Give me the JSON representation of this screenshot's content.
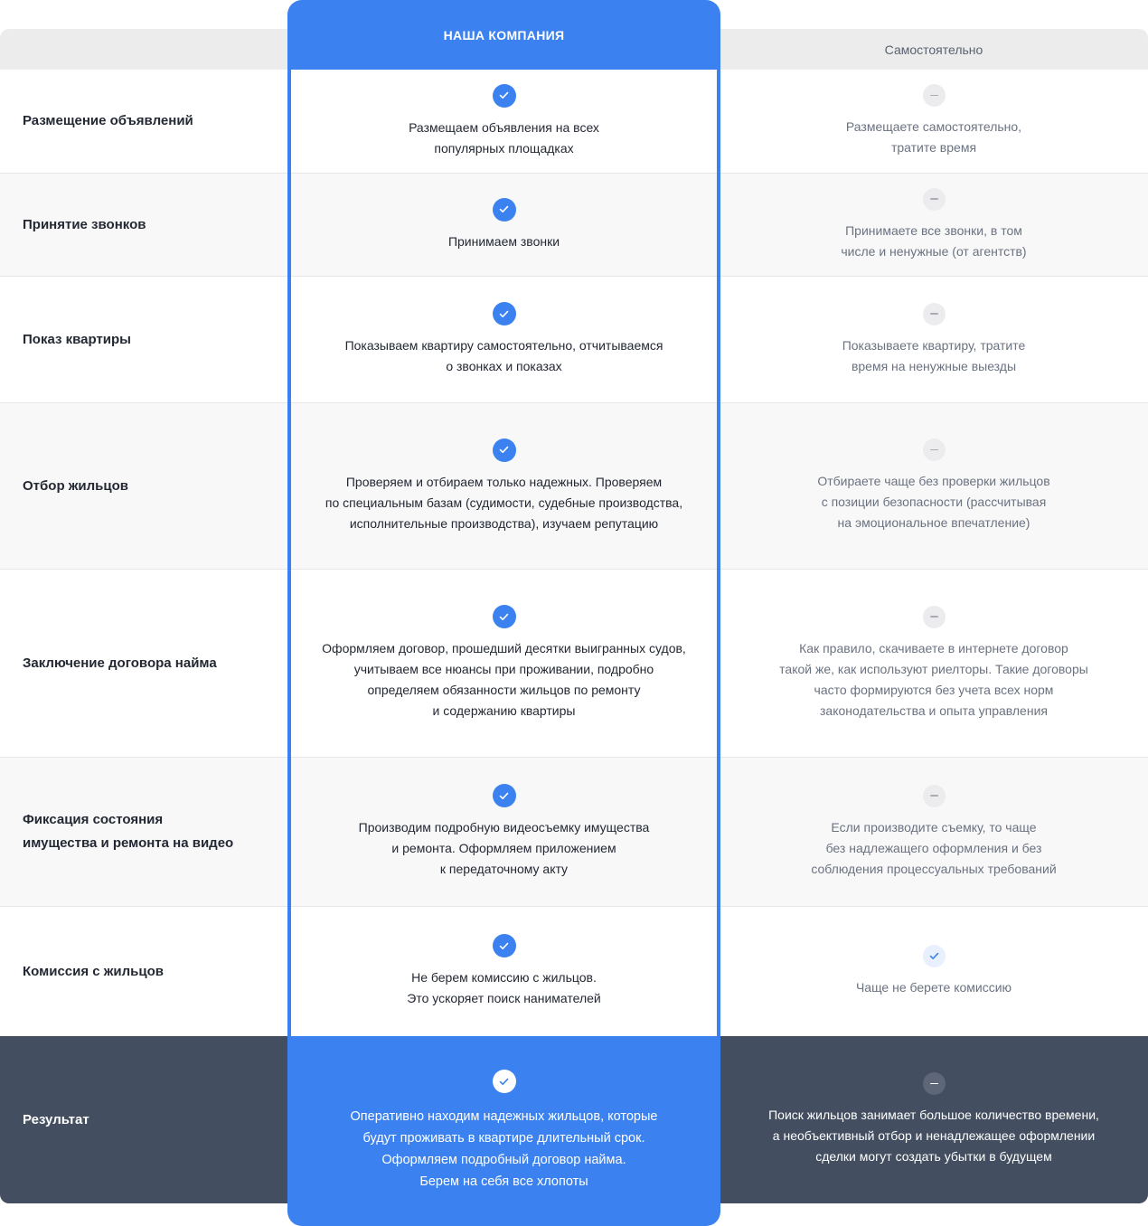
{
  "header": {
    "company_title": "НАША КОМПАНИЯ",
    "self_title": "Самостоятельно"
  },
  "rows": [
    {
      "label": "Размещение объявлений",
      "company_lines": [
        "Размещаем объявления на всех",
        "популярных площадках"
      ],
      "company_icon": "check-icon",
      "self_lines": [
        "Размещаете самостоятельно,",
        "тратите время"
      ],
      "self_icon": "minus-icon"
    },
    {
      "label": "Принятие звонков",
      "company_lines": [
        "Принимаем звонки"
      ],
      "company_icon": "check-icon",
      "self_lines": [
        "Принимаете все звонки, в том",
        "числе и ненужные (от агентств)"
      ],
      "self_icon": "minus-icon"
    },
    {
      "label": "Показ квартиры",
      "company_lines": [
        "Показываем квартиру самостоятельно, отчитываемся",
        "о звонках и показах"
      ],
      "company_icon": "check-icon",
      "self_lines": [
        "Показываете квартиру, тратите",
        "время на ненужные выезды"
      ],
      "self_icon": "minus-icon"
    },
    {
      "label": "Отбор жильцов",
      "company_lines": [
        "Проверяем и отбираем только надежных. Проверяем",
        "по специальным базам (судимости, судебные производства,",
        "исполнительные производства), изучаем репутацию"
      ],
      "company_icon": "check-icon",
      "self_lines": [
        "Отбираете чаще без проверки жильцов",
        "с позиции безопасности (рассчитывая",
        "на эмоциональное впечатление)"
      ],
      "self_icon": "minus-icon"
    },
    {
      "label": "Заключение договора найма",
      "company_lines": [
        "Оформляем договор, прошедший десятки выигранных судов,",
        "учитываем все нюансы при проживании, подробно",
        "определяем обязанности жильцов по ремонту",
        "и содержанию квартиры"
      ],
      "company_icon": "check-icon",
      "self_lines": [
        "Как правило, скачиваете в интернете договор",
        "такой же, как используют риелторы. Такие договоры",
        "часто формируются без учета всех норм",
        "законодательства и опыта управления"
      ],
      "self_icon": "minus-icon"
    },
    {
      "label_lines": [
        "Фиксация состояния",
        "имущества и ремонта на видео"
      ],
      "company_lines": [
        "Производим подробную видеосъемку имущества",
        "и ремонта. Оформляем приложением",
        "к передаточному акту"
      ],
      "company_icon": "check-icon",
      "self_lines": [
        "Если производите съемку, то чаще",
        "без надлежащего оформления и без",
        "соблюдения процессуальных требований"
      ],
      "self_icon": "minus-icon"
    },
    {
      "label": "Комиссия с жильцов",
      "company_lines": [
        "Не берем комиссию с жильцов.",
        "Это ускоряет поиск нанимателей"
      ],
      "company_icon": "check-icon",
      "self_lines": [
        "Чаще не берете комиссию"
      ],
      "self_icon": "check-light-icon"
    }
  ],
  "result": {
    "label": "Результат",
    "company_lines": [
      "Оперативно находим надежных жильцов, которые",
      "будут проживать в квартире длительный срок.",
      "Оформляем подробный договор найма.",
      "Берем на себя все хлопоты"
    ],
    "company_icon": "check-white-icon",
    "self_lines": [
      "Поиск жильцов занимает большое количество времени,",
      "а необъективный отбор и ненадлежащее оформлении",
      "сделки могут создать убытки в будущем"
    ],
    "self_icon": "minus-icon"
  },
  "colors": {
    "accent": "#3b82f0",
    "result_bg": "#434e60",
    "header_bg": "#ececec"
  }
}
